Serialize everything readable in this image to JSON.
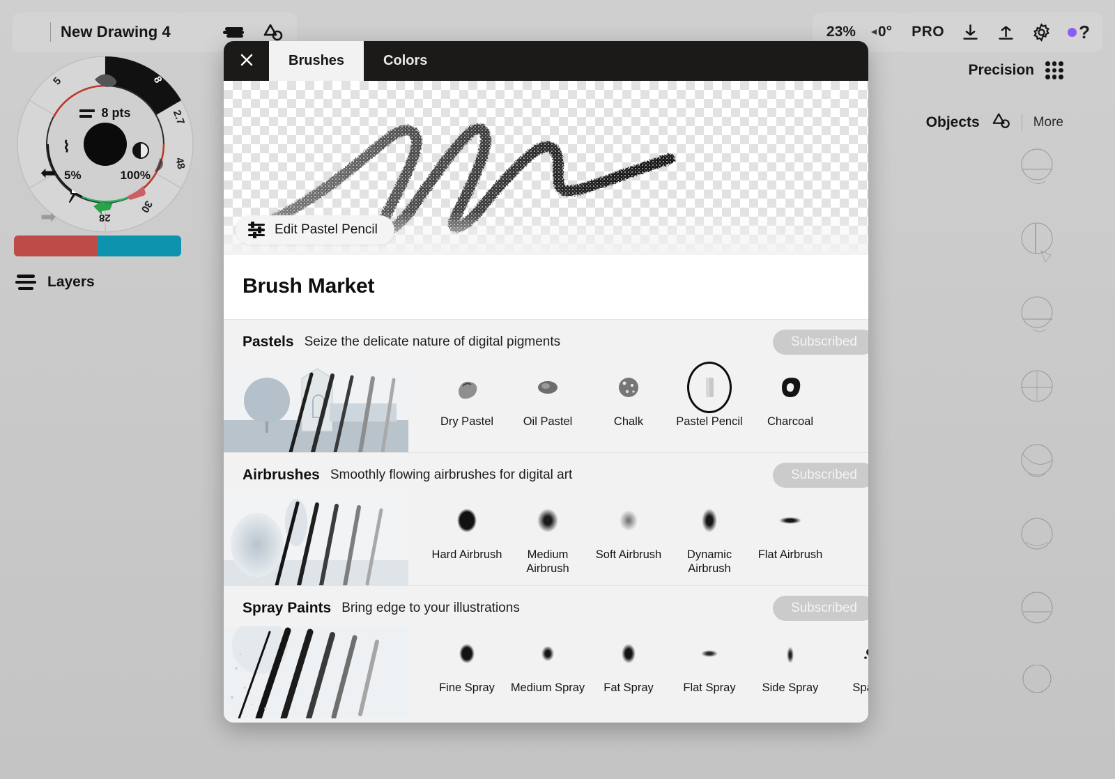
{
  "app": {
    "document_title": "New Drawing 4",
    "zoom": "23%",
    "rotation": "0°",
    "pro_label": "PRO",
    "icons": {
      "apps": "grid-4-icon",
      "dots": "dots-grid-icon",
      "layers_stack": "layers-stack-icon",
      "shape_tool": "shape-node-icon",
      "download": "download-icon",
      "upload": "upload-icon",
      "settings": "gear-icon",
      "help": "help-icon"
    }
  },
  "left_panel": {
    "wheel": {
      "size_label": "8 pts",
      "opacity_left": "5%",
      "opacity_right": "100%",
      "segments": [
        "5",
        "8",
        "2.7",
        "48",
        "30",
        "28"
      ]
    },
    "swatches": [
      {
        "name": "primary",
        "color": "#bd4b48"
      },
      {
        "name": "secondary",
        "color": "#0e93ae"
      }
    ],
    "layers_label": "Layers"
  },
  "right_panel": {
    "precision_label": "Precision",
    "objects_label": "Objects",
    "more_label": "More",
    "object_count": 8
  },
  "modal": {
    "close_label": "✕",
    "tabs": [
      {
        "label": "Brushes",
        "active": true
      },
      {
        "label": "Colors",
        "active": false
      }
    ],
    "edit_button_label": "Edit Pastel Pencil",
    "market_title": "Brush Market",
    "sections": [
      {
        "name": "Pastels",
        "description": "Seize the delicate nature of digital pigments",
        "badge": "Subscribed",
        "brushes": [
          {
            "label": "Dry Pastel",
            "selected": false
          },
          {
            "label": "Oil Pastel",
            "selected": false
          },
          {
            "label": "Chalk",
            "selected": false
          },
          {
            "label": "Pastel Pencil",
            "selected": true
          },
          {
            "label": "Charcoal",
            "selected": false
          }
        ]
      },
      {
        "name": "Airbrushes",
        "description": "Smoothly flowing airbrushes for digital art",
        "badge": "Subscribed",
        "brushes": [
          {
            "label": "Hard Airbrush",
            "selected": false
          },
          {
            "label": "Medium Airbrush",
            "selected": false
          },
          {
            "label": "Soft Airbrush",
            "selected": false
          },
          {
            "label": "Dynamic Airbrush",
            "selected": false
          },
          {
            "label": "Flat Airbrush",
            "selected": false
          }
        ]
      },
      {
        "name": "Spray Paints",
        "description": "Bring edge to your illustrations",
        "badge": "Subscribed",
        "brushes": [
          {
            "label": "Fine Spray",
            "selected": false
          },
          {
            "label": "Medium Spray",
            "selected": false
          },
          {
            "label": "Fat Spray",
            "selected": false
          },
          {
            "label": "Flat Spray",
            "selected": false
          },
          {
            "label": "Side Spray",
            "selected": false
          },
          {
            "label": "Spatter",
            "selected": false
          }
        ]
      }
    ]
  }
}
